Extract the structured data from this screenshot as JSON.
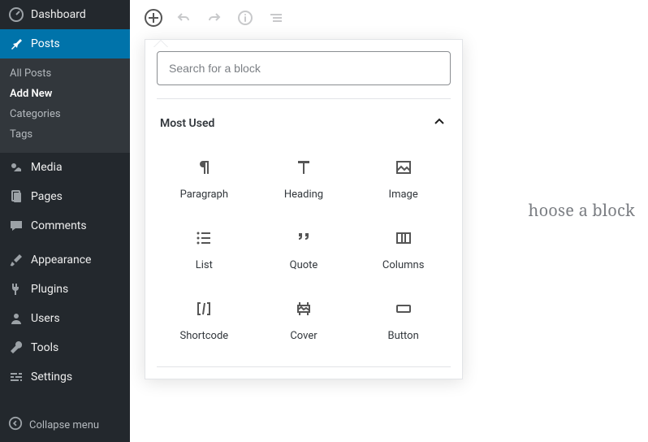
{
  "sidebar": {
    "items": [
      {
        "label": "Dashboard",
        "icon": "dashboard"
      },
      {
        "label": "Posts",
        "icon": "pin"
      },
      {
        "label": "Media",
        "icon": "media"
      },
      {
        "label": "Pages",
        "icon": "pages"
      },
      {
        "label": "Comments",
        "icon": "comment"
      },
      {
        "label": "Appearance",
        "icon": "brush"
      },
      {
        "label": "Plugins",
        "icon": "plug"
      },
      {
        "label": "Users",
        "icon": "user"
      },
      {
        "label": "Tools",
        "icon": "wrench"
      },
      {
        "label": "Settings",
        "icon": "sliders"
      }
    ],
    "active_index": 1,
    "posts_submenu": [
      {
        "label": "All Posts",
        "current": false
      },
      {
        "label": "Add New",
        "current": true
      },
      {
        "label": "Categories",
        "current": false
      },
      {
        "label": "Tags",
        "current": false
      }
    ],
    "collapse_label": "Collapse menu"
  },
  "toolbar": {
    "add": "Add block",
    "undo": "Undo",
    "redo": "Redo",
    "info": "Content structure",
    "outline": "Block navigation"
  },
  "inserter": {
    "search_placeholder": "Search for a block",
    "section_title": "Most Used",
    "blocks": [
      {
        "label": "Paragraph",
        "icon": "paragraph"
      },
      {
        "label": "Heading",
        "icon": "heading"
      },
      {
        "label": "Image",
        "icon": "image"
      },
      {
        "label": "List",
        "icon": "list"
      },
      {
        "label": "Quote",
        "icon": "quote"
      },
      {
        "label": "Columns",
        "icon": "columns"
      },
      {
        "label": "Shortcode",
        "icon": "shortcode"
      },
      {
        "label": "Cover",
        "icon": "cover"
      },
      {
        "label": "Button",
        "icon": "button"
      }
    ]
  },
  "canvas": {
    "placeholder_fragment": "hoose a block"
  }
}
